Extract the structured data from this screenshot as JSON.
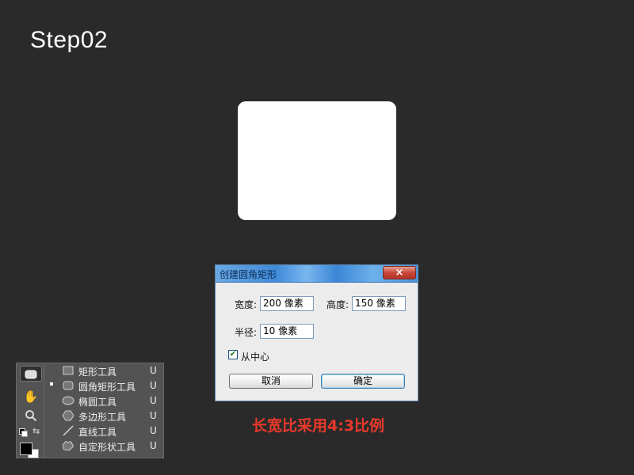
{
  "step_title": "Step02",
  "caption": "长宽比采用4:3比例",
  "dialog": {
    "title": "创建圆角矩形",
    "close_label": "×",
    "width_label": "宽度:",
    "width_value": "200 像素",
    "height_label": "高度:",
    "height_value": "150 像素",
    "radius_label": "半径:",
    "radius_value": "10 像素",
    "from_center_label": "从中心",
    "from_center_checked": true,
    "cancel_label": "取消",
    "ok_label": "确定"
  },
  "tools_flyout": {
    "items": [
      {
        "label": "矩形工具",
        "key": "U",
        "icon": "rectangle-icon",
        "selected": false
      },
      {
        "label": "圆角矩形工具",
        "key": "U",
        "icon": "rounded-rectangle-icon",
        "selected": true
      },
      {
        "label": "椭圆工具",
        "key": "U",
        "icon": "ellipse-icon",
        "selected": false
      },
      {
        "label": "多边形工具",
        "key": "U",
        "icon": "polygon-icon",
        "selected": false
      },
      {
        "label": "直线工具",
        "key": "U",
        "icon": "line-icon",
        "selected": false
      },
      {
        "label": "自定形状工具",
        "key": "U",
        "icon": "custom-shape-icon",
        "selected": false
      }
    ]
  },
  "colors": {
    "background": "#2a2a2a",
    "caption": "#e8392a",
    "panel": "#535353"
  }
}
